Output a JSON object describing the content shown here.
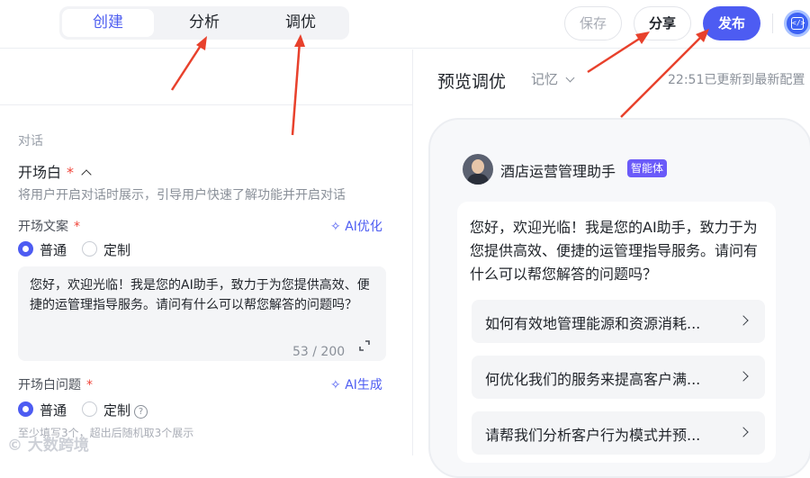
{
  "header": {
    "tabs": [
      {
        "label": "创建",
        "active": true
      },
      {
        "label": "分析",
        "active": false
      },
      {
        "label": "调优",
        "active": false
      }
    ],
    "save_label": "保存",
    "share_label": "分享",
    "publish_label": "发布",
    "code_icon_label": "</>"
  },
  "left_panel": {
    "section_label": "对话",
    "opening_title": "开场白",
    "required_mark": "*",
    "opening_desc": "将用户开启对话时展示，引导用户快速了解功能并开启对话",
    "copy_label": "开场文案",
    "ai_optimize": "AI优化",
    "copy_options": [
      {
        "label": "普通",
        "selected": true
      },
      {
        "label": "定制",
        "selected": false
      }
    ],
    "copy_text": "您好，欢迎光临！我是您的AI助手，致力于为您提供高效、便捷的运管理指导服务。请问有什么可以帮您解答的问题吗？",
    "char_count": "53 / 200",
    "question_label": "开场白问题",
    "ai_generate": "AI生成",
    "question_options": [
      {
        "label": "普通",
        "selected": true
      },
      {
        "label": "定制",
        "selected": false
      }
    ],
    "question_hint": "至少填写3个，超出后随机取3个展示",
    "help_mark": "?"
  },
  "watermark": "大数跨境",
  "preview": {
    "title": "预览调优",
    "memory_label": "记忆",
    "update_status": "22:51已更新到最新配置",
    "bot_name": "酒店运营管理助手",
    "bot_badge": "智能体",
    "greeting": "您好，欢迎光临！我是您的AI助手，致力于为您提供高效、便捷的运管理指导服务。请问有什么可以帮您解答的问题吗？",
    "questions": [
      "如何有效地管理能源和资源消耗...",
      "何优化我们的服务来提高客户满...",
      "请帮我们分析客户行为模式并预..."
    ]
  },
  "colors": {
    "accent": "#4d5cf2",
    "required": "#f04438",
    "annotation_arrow": "#e8412c"
  }
}
